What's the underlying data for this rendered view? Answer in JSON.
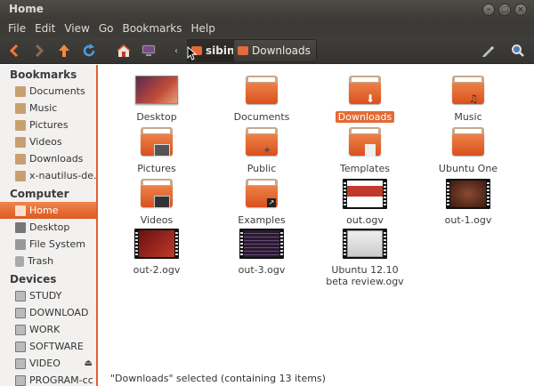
{
  "window": {
    "title": "Home"
  },
  "menu": [
    "File",
    "Edit",
    "View",
    "Go",
    "Bookmarks",
    "Help"
  ],
  "path": {
    "home": "sibin",
    "child": "Downloads"
  },
  "sidebar": {
    "bookmarks_header": "Bookmarks",
    "bookmarks": [
      "Documents",
      "Music",
      "Pictures",
      "Videos",
      "Downloads",
      "x-nautilus-de..."
    ],
    "computer_header": "Computer",
    "computer": [
      "Home",
      "Desktop",
      "File System",
      "Trash"
    ],
    "devices_header": "Devices",
    "devices": [
      "STUDY",
      "DOWNLOAD",
      "WORK",
      "SOFTWARE",
      "VIDEO",
      "PROGRAM-cc"
    ]
  },
  "files": [
    {
      "name": "Desktop",
      "kind": "desktop"
    },
    {
      "name": "Documents",
      "kind": "folder"
    },
    {
      "name": "Downloads",
      "kind": "folder-download",
      "selected": true
    },
    {
      "name": "Music",
      "kind": "folder-music"
    },
    {
      "name": "Pictures",
      "kind": "folder-pictures"
    },
    {
      "name": "Public",
      "kind": "folder-public"
    },
    {
      "name": "Templates",
      "kind": "folder-templates"
    },
    {
      "name": "Ubuntu One",
      "kind": "folder"
    },
    {
      "name": "Videos",
      "kind": "folder-videos"
    },
    {
      "name": "Examples",
      "kind": "folder-link"
    },
    {
      "name": "out.ogv",
      "kind": "video-slide"
    },
    {
      "name": "out-1.ogv",
      "kind": "video-dark"
    },
    {
      "name": "out-2.ogv",
      "kind": "video-red"
    },
    {
      "name": "out-3.ogv",
      "kind": "video-purple"
    },
    {
      "name": "Ubuntu 12.10 beta review.ogv",
      "kind": "video-white"
    }
  ],
  "status": "\"Downloads\" selected (containing 13 items)",
  "colors": {
    "accent": "#e46a34",
    "dark": "#3c3b37"
  }
}
